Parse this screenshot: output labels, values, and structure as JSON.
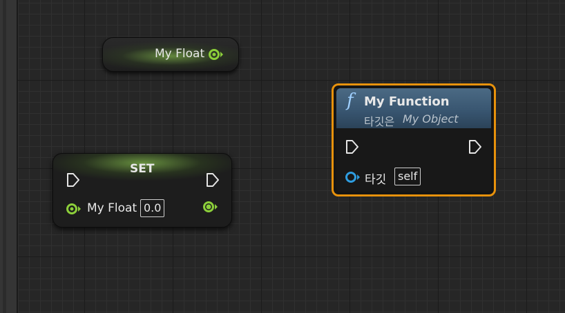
{
  "getter_node": {
    "label": "My Float",
    "pin_color": "#8ccf3a"
  },
  "set_node": {
    "title": "SET",
    "input_label": "My Float",
    "input_value": "0.0",
    "pin_color": "#8ccf3a"
  },
  "function_node": {
    "icon": "f",
    "title": "My Function",
    "subtitle_prefix": "타깃은",
    "subtitle_object": "My Object",
    "target_label": "타깃",
    "target_value": "self",
    "target_pin_color": "#2e9de0",
    "border_color": "#e8920c"
  }
}
